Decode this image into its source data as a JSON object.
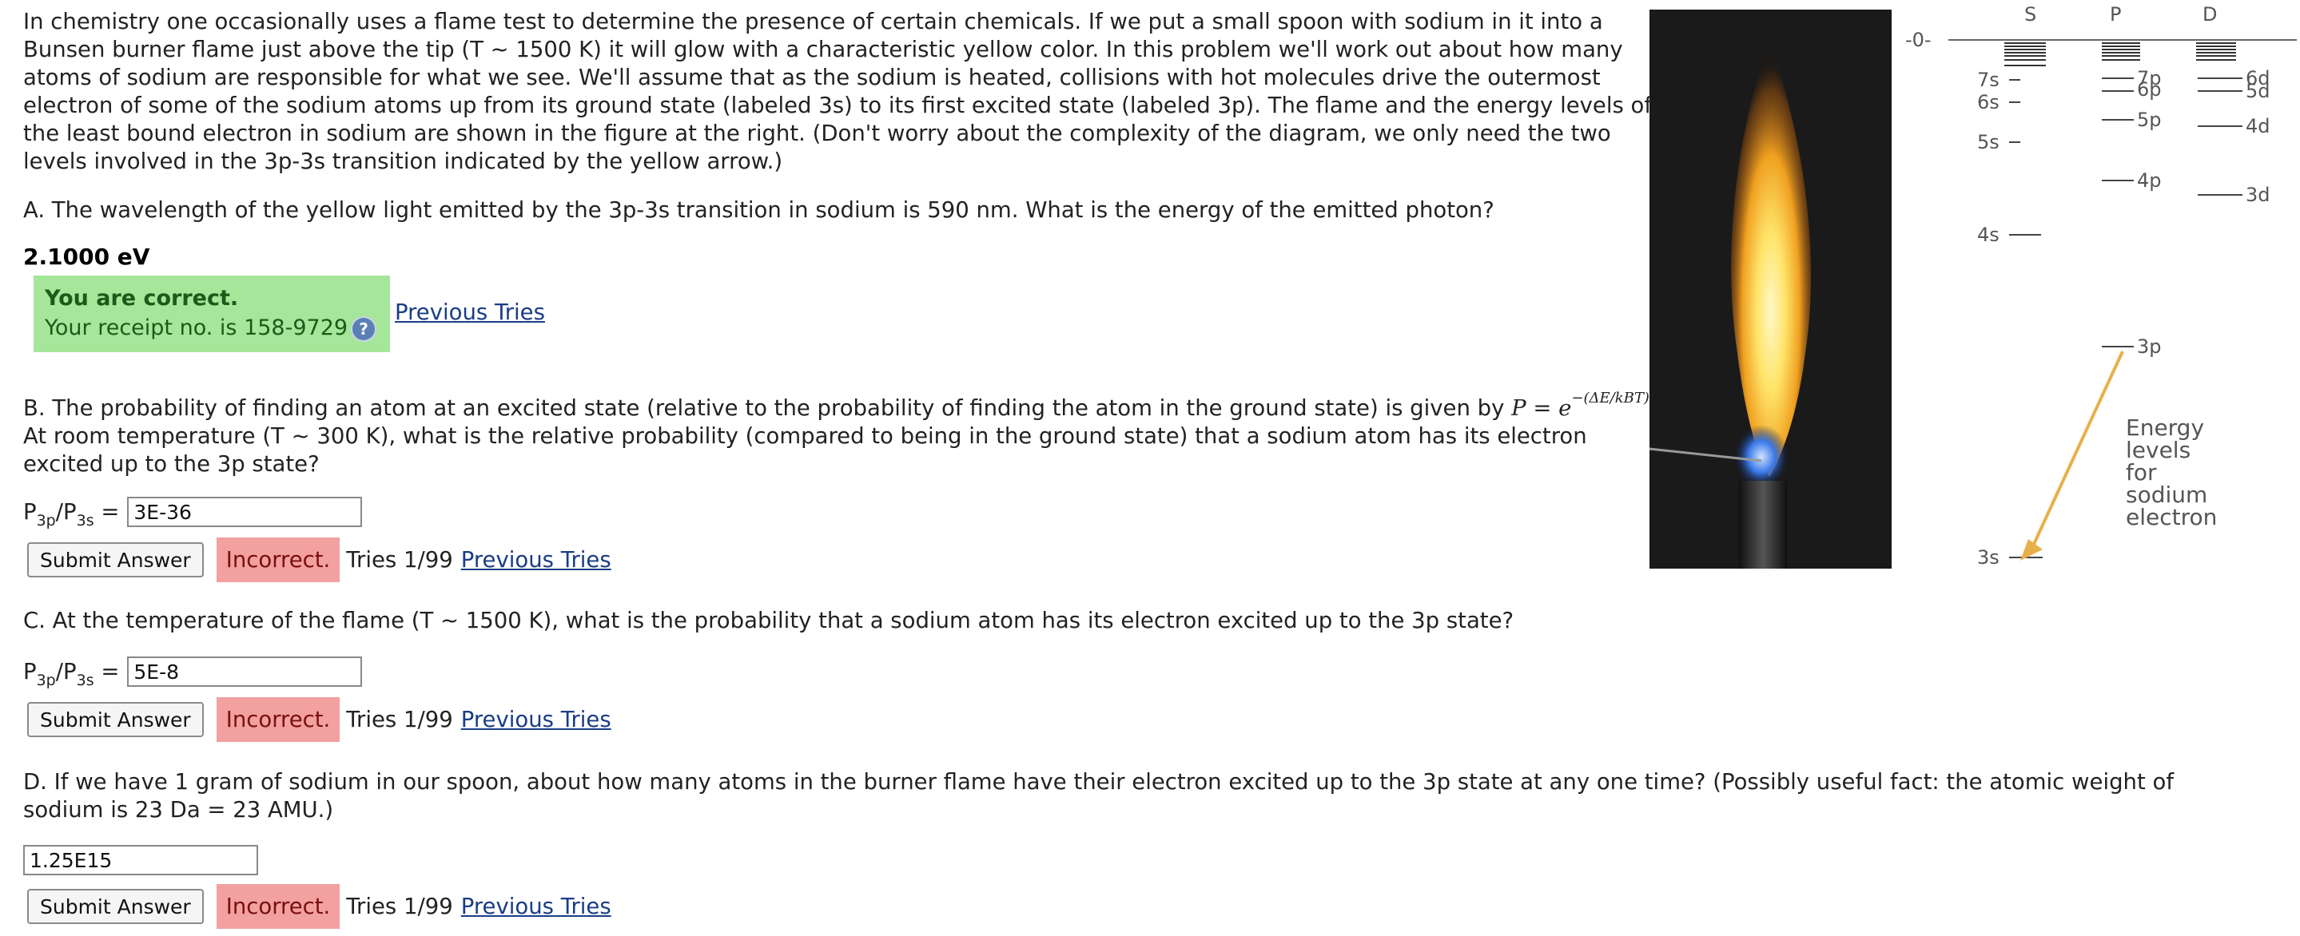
{
  "intro": "In chemistry one occasionally uses a flame test to determine the presence of certain chemicals. If we put a small spoon with sodium in it into a Bunsen burner flame just above the tip (T ~ 1500 K) it will glow with a characteristic yellow color. In this problem we'll work out about how many atoms of sodium are responsible for what we see. We'll assume that as the sodium is heated, collisions with hot molecules drive the outermost electron of some of the sodium atoms up from its ground state (labeled 3s) to its first excited state (labeled 3p). The flame and the energy levels of the least bound electron in sodium are shown in the figure at the right. (Don't worry about the complexity of the diagram, we only need the two levels involved in the 3p-3s transition indicated by the yellow arrow.)",
  "qa": {
    "question": "A. The wavelength of the yellow light emitted by the 3p-3s transition in sodium is 590 nm. What is the energy of the emitted photon?",
    "answer": "2.1000 eV",
    "status_title": "You are correct.",
    "receipt": "Your receipt no. is 158-9729",
    "help_icon": "?",
    "previous_tries": "Previous Tries"
  },
  "qb": {
    "question_pre": "B. The probability of finding an atom at an excited state (relative to the probability of finding the atom in the ground state) is given by",
    "formula_lhs": "P = e",
    "formula_exp": "−(ΔE/kBT)",
    "question_post": "At room temperature (T ~ 300 K), what is the relative probability (compared to being in the ground state) that a sodium atom has its electron excited up to the 3p state?",
    "label_p": "P",
    "label_sub1": "3p",
    "label_slash": "/P",
    "label_sub2": "3s",
    "label_eq": "=",
    "value": "3E-36",
    "submit": "Submit Answer",
    "status": "Incorrect.",
    "tries": "Tries 1/99",
    "previous_tries": "Previous Tries"
  },
  "qc": {
    "question": "C. At the temperature of the flame (T ~ 1500 K), what is the probability that a sodium atom has its electron excited up to the 3p state?",
    "label_p": "P",
    "label_sub1": "3p",
    "label_slash": "/P",
    "label_sub2": "3s",
    "label_eq": "=",
    "value": "5E-8",
    "submit": "Submit Answer",
    "status": "Incorrect.",
    "tries": "Tries 1/99",
    "previous_tries": "Previous Tries"
  },
  "qd": {
    "question": "D. If we have 1 gram of sodium in our spoon, about how many atoms in the burner flame have their electron excited up to the 3p state at any one time? (Possibly useful fact: the atomic weight of sodium is 23 Da = 23 AMU.)",
    "value": "1.25E15",
    "submit": "Submit Answer",
    "status": "Incorrect.",
    "tries": "Tries 1/99",
    "previous_tries": "Previous Tries"
  },
  "diagram": {
    "col_s": "S",
    "col_p": "P",
    "col_d": "D",
    "zero": "-0-",
    "s_levels": [
      "7s",
      "6s",
      "5s",
      "4s",
      "3s"
    ],
    "p_levels": [
      "7p",
      "6p",
      "5p",
      "4p",
      "3p"
    ],
    "d_levels": [
      "6d",
      "5d",
      "4d",
      "3d"
    ],
    "caption_lines": [
      "Energy",
      "levels",
      "for",
      "sodium",
      "electron"
    ]
  },
  "colors": {
    "correct_bg": "#a6e69a",
    "incorrect_bg": "#f2a0a0",
    "link": "#1a3d85",
    "arrow": "#e8b04a"
  }
}
